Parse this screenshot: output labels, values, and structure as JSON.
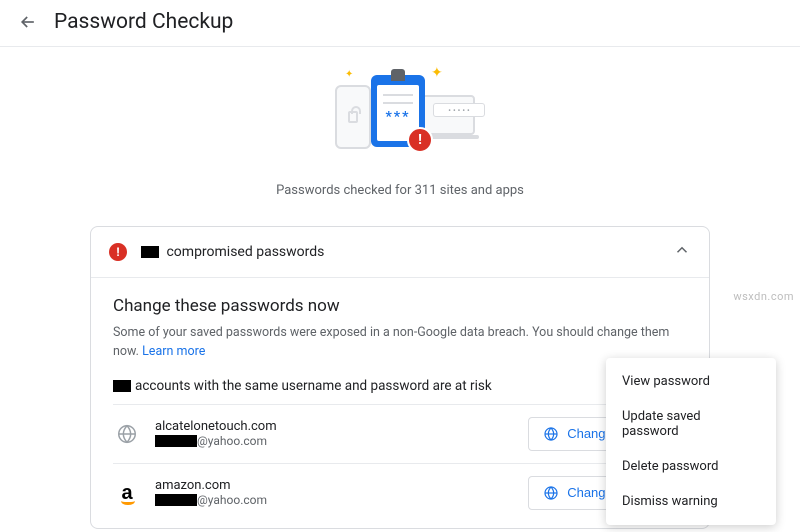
{
  "header": {
    "title": "Password Checkup"
  },
  "hero": {
    "caption": "Passwords checked for 311 sites and apps",
    "clipboard_stars": "***",
    "alert_glyph": "!"
  },
  "card": {
    "head_suffix": " compromised passwords",
    "warn_title": "Change these passwords now",
    "warn_desc": "Some of your saved passwords were exposed in a non-Google data breach. You should change them now. ",
    "learn_more": "Learn more",
    "risk_suffix": "accounts with the same username and password are at risk",
    "change_label": "Change password",
    "accounts": [
      {
        "site": "alcatelonetouch.com",
        "user_domain": "@yahoo.com",
        "icon": "globe"
      },
      {
        "site": "amazon.com",
        "user_domain": "@yahoo.com",
        "icon": "amazon"
      }
    ]
  },
  "menu": {
    "items": [
      "View password",
      "Update saved password",
      "Delete password",
      "Dismiss warning"
    ]
  },
  "watermark": "wsxdn.com"
}
